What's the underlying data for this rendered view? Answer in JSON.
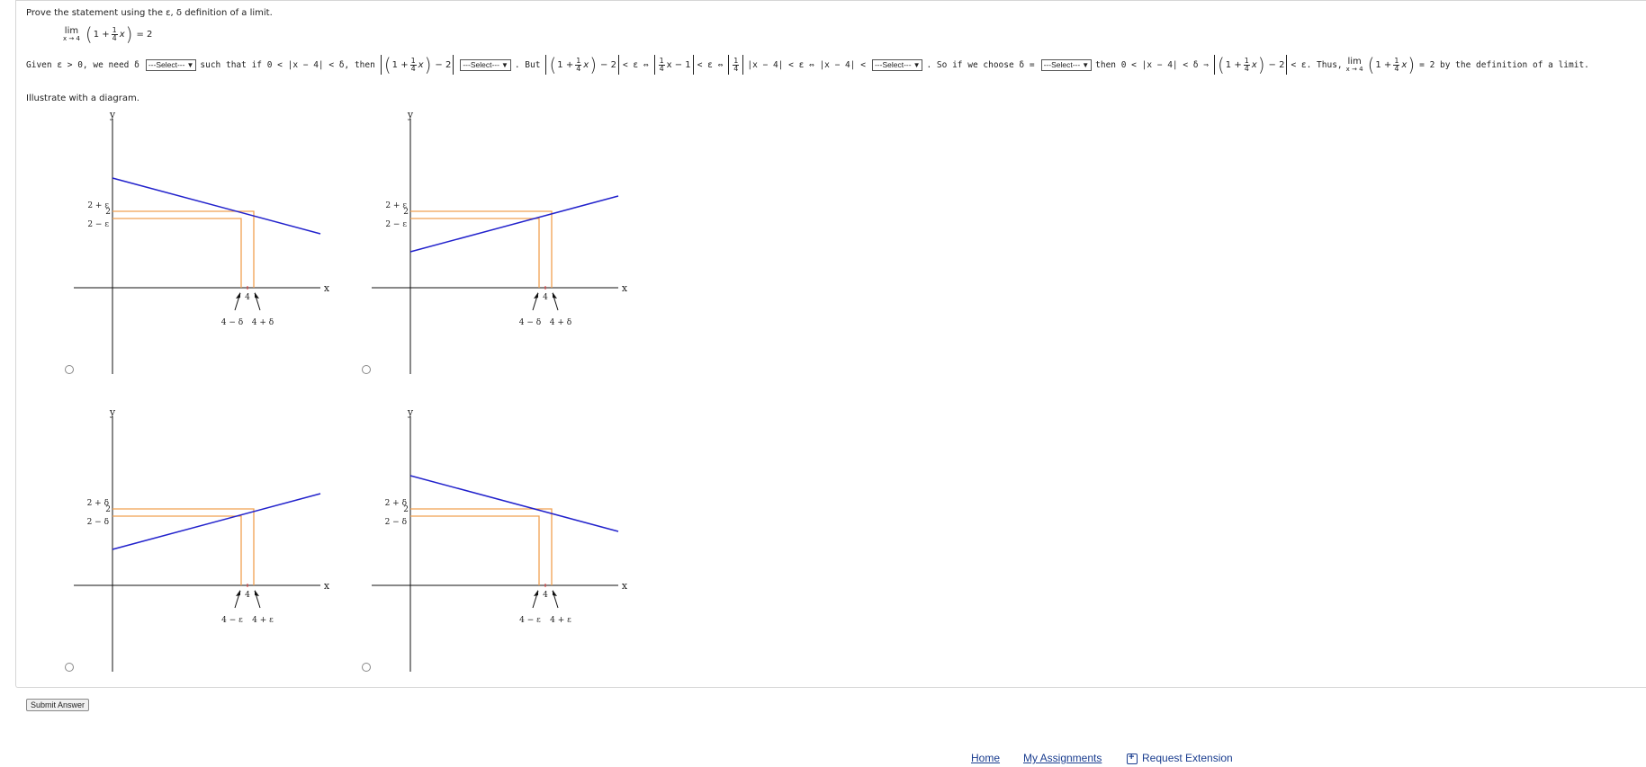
{
  "prompt": "Prove the statement using the ε, δ definition of a limit.",
  "limit": {
    "lim": "lim",
    "sub": "x → 4",
    "one_plus": "1 +",
    "num": "1",
    "den": "4",
    "x": "x",
    "equals": "= 2"
  },
  "row": {
    "given": "Given ε > 0, we need δ",
    "select_label": "---Select---",
    "such_that": "such that if 0 < |x − 4| < δ, then",
    "one_plus": "1 +",
    "minus2": "− 2",
    "but": ". But",
    "lt_eps_iff": "< ε ⇔",
    "quarter_x_minus1": "x − 1",
    "lt_eps_iff2": "< ε ⇔",
    "abs_x4": "|x − 4| < ε ⇔ |x − 4| <",
    "so_if": ". So if we choose δ =",
    "then": "then 0 < |x − 4| < δ ⇒",
    "lt_eps_thus": "< ε. Thus,",
    "lim": "lim",
    "lim_sub": "x → 4",
    "eq2_def": "= 2 by the definition of a limit.",
    "num": "1",
    "den": "4",
    "x": "x"
  },
  "illustrate": "Illustrate with a diagram.",
  "graphs": [
    {
      "id": "a",
      "y_label": "y",
      "x_label": "x",
      "top_label": "2 + ε",
      "mid_label": "2",
      "bot_label": "2 − ε",
      "center_label": "4",
      "left_label": "4 − δ",
      "right_label": "4 + δ",
      "slope": "negative"
    },
    {
      "id": "b",
      "y_label": "y",
      "x_label": "x",
      "top_label": "2 + ε",
      "mid_label": "2",
      "bot_label": "2 − ε",
      "center_label": "4",
      "left_label": "4 − δ",
      "right_label": "4 + δ",
      "slope": "positive"
    },
    {
      "id": "c",
      "y_label": "y",
      "x_label": "x",
      "top_label": "2 + δ",
      "mid_label": "2",
      "bot_label": "2 − δ",
      "center_label": "4",
      "left_label": "4 − ε",
      "right_label": "4 + ε",
      "slope": "positive"
    },
    {
      "id": "d",
      "y_label": "y",
      "x_label": "x",
      "top_label": "2 + δ",
      "mid_label": "2",
      "bot_label": "2 − δ",
      "center_label": "4",
      "left_label": "4 − ε",
      "right_label": "4 + ε",
      "slope": "negative"
    }
  ],
  "submit_label": "Submit Answer",
  "footer": {
    "home": "Home",
    "assignments": "My Assignments",
    "extension": "Request Extension"
  },
  "colors": {
    "line": "#2222cc",
    "band": "#f0a050",
    "axis": "#111111",
    "link": "#1a3d8f"
  }
}
